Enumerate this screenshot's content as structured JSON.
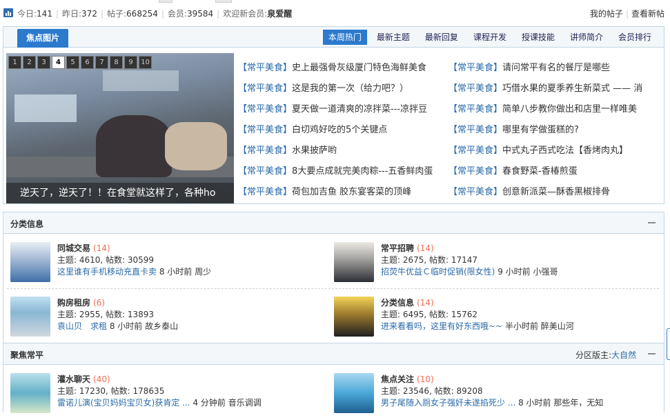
{
  "stats": {
    "today_label": "今日:",
    "today_value": "141",
    "yesterday_label": "昨日:",
    "yesterday_value": "372",
    "posts_label": "帖子:",
    "posts_value": "668254",
    "members_label": "会员:",
    "members_value": "39584",
    "welcome_label": "欢迎新会员:",
    "new_member": "泉爱醒"
  },
  "toplinks": {
    "my_posts": "我的帖子",
    "new_posts": "查看新帖"
  },
  "focus": {
    "title": "焦点图片",
    "tabs": [
      "本周热门",
      "最新主题",
      "最新回复",
      "课程开发",
      "授课技能",
      "讲师简介",
      "会员排行"
    ],
    "active_tab": 0,
    "slider_numbers": [
      "1",
      "2",
      "3",
      "4",
      "5",
      "6",
      "7",
      "8",
      "9",
      "10"
    ],
    "active_number": 3,
    "caption": "逆天了，逆天了！！在食堂就这样了，各种ho",
    "tag": "常平美食",
    "hot_left": [
      "史上最强骨灰级厦门特色海鲜美食",
      "这是我的第一次（给力吧？）",
      "夏天做一道清爽的凉拌菜---凉拌豆",
      "白切鸡好吃的5个关键点",
      "水果披萨哟",
      "8大要点成就完美肉粽---五香鲜肉蛋",
      "荷包加吉鱼 胶东宴客菜的顶峰"
    ],
    "hot_right": [
      "请问常平有名的餐厅是哪些",
      "巧借水果的夏季养生新菜式 —— 消",
      "简单八步教你做出和店里一样唯美",
      "哪里有学做蛋糕的?",
      "中式丸子西式吃法【香烤肉丸】",
      "春食野菜-香椿煎蛋",
      "创意新派菜—酥香黑椒排骨"
    ]
  },
  "classified": {
    "title": "分类信息",
    "forums": [
      {
        "name": "同城交易",
        "count": "(14)",
        "stats": "主题: 4610, 帖数: 30599",
        "last_link": "这里谁有手机移动充直卡卖",
        "last_info": "8 小时前 周少"
      },
      {
        "name": "常平招聘",
        "count": "(14)",
        "stats": "主题: 2675, 帖数: 17147",
        "last_link": "招荧牛优益Ｃ临时促销(限女性)",
        "last_info": "9 小时前 小强哥"
      },
      {
        "name": "购房租房",
        "count": "(6)",
        "stats": "主题: 2955, 帖数: 13893",
        "last_link": "袁山贝　求租",
        "last_info": "8 小时前 故乡泰山"
      },
      {
        "name": "分类信息",
        "count": "(14)",
        "stats": "主题: 6495, 帖数: 15762",
        "last_link": "进来看看吗，这里有好东西哦~~",
        "last_info": "半小时前 醉美山河"
      }
    ]
  },
  "gather": {
    "title": "聚焦常平",
    "moderator_label": "分区版主:",
    "moderator": "大自然",
    "forums": [
      {
        "name": "灌水聊天",
        "count": "(40)",
        "stats": "主题: 17230, 帖数: 178635",
        "last_link": "雷诺儿演(宝贝妈妈宝贝女)获肯定 ...",
        "last_info": "4 分钟前 音乐调调"
      },
      {
        "name": "焦点关注",
        "count": "(10)",
        "stats": "主题: 23546, 帖数: 89208",
        "last_link": "男子尾随入厕女子强奸未遂掐死少 ...",
        "last_info": "8 小时前 那些年，无知"
      }
    ]
  },
  "colors": {
    "accent": "#2b7acd",
    "link": "#2a6aa8",
    "forum_name": "#8b0000",
    "count": "#f26c4f"
  }
}
